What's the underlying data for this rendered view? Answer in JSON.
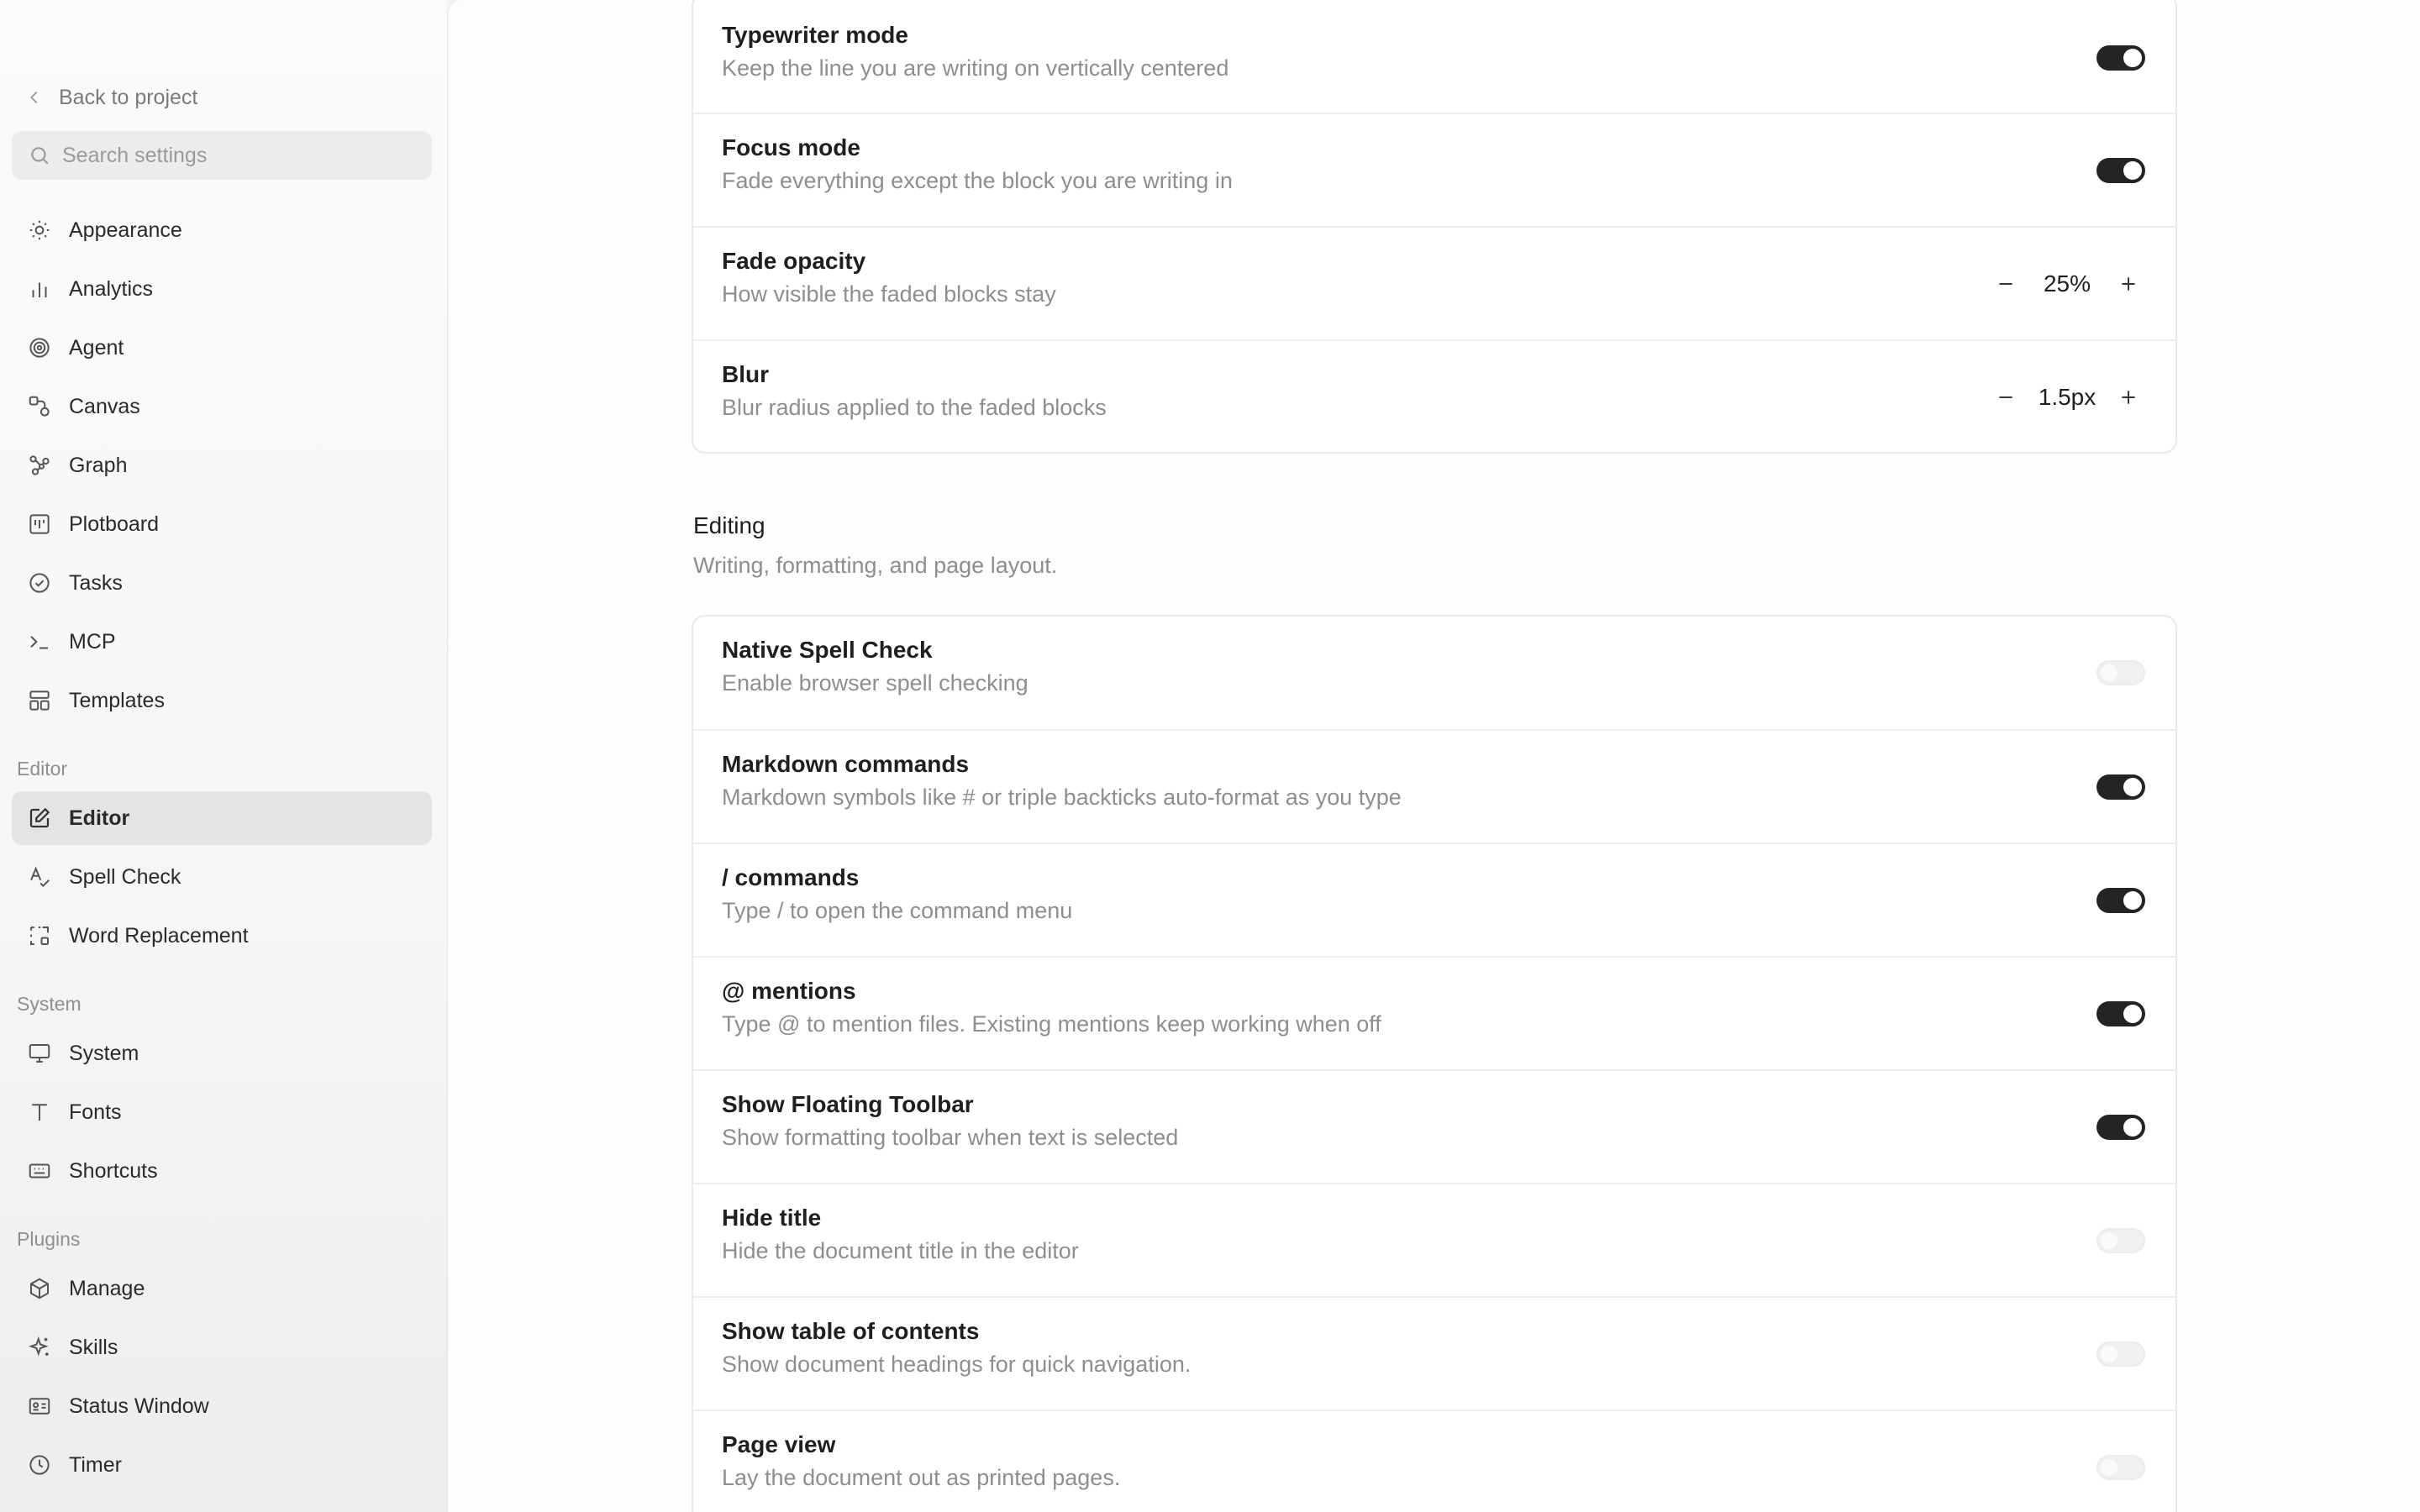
{
  "sidebar": {
    "back_label": "Back to project",
    "search_placeholder": "Search settings",
    "items": [
      {
        "label": "Appearance",
        "icon": "sun-icon"
      },
      {
        "label": "Analytics",
        "icon": "bar-chart-icon"
      },
      {
        "label": "Agent",
        "icon": "agent-icon"
      },
      {
        "label": "Canvas",
        "icon": "canvas-icon"
      },
      {
        "label": "Graph",
        "icon": "graph-icon"
      },
      {
        "label": "Plotboard",
        "icon": "plotboard-icon"
      },
      {
        "label": "Tasks",
        "icon": "check-circle-icon"
      },
      {
        "label": "MCP",
        "icon": "terminal-icon"
      },
      {
        "label": "Templates",
        "icon": "templates-icon"
      }
    ],
    "editor_section": {
      "title": "Editor",
      "items": [
        {
          "label": "Editor",
          "icon": "edit-icon",
          "active": true
        },
        {
          "label": "Spell Check",
          "icon": "spell-check-icon"
        },
        {
          "label": "Word Replacement",
          "icon": "replace-icon"
        }
      ]
    },
    "system_section": {
      "title": "System",
      "items": [
        {
          "label": "System",
          "icon": "monitor-icon"
        },
        {
          "label": "Fonts",
          "icon": "type-icon"
        },
        {
          "label": "Shortcuts",
          "icon": "keyboard-icon"
        }
      ]
    },
    "plugins_section": {
      "title": "Plugins",
      "items": [
        {
          "label": "Manage",
          "icon": "package-icon"
        },
        {
          "label": "Skills",
          "icon": "sparkles-icon"
        },
        {
          "label": "Status Window",
          "icon": "id-card-icon"
        },
        {
          "label": "Timer",
          "icon": "clock-icon"
        }
      ]
    }
  },
  "focus_card": {
    "rows": [
      {
        "title": "Typewriter mode",
        "desc": "Keep the line you are writing on vertically centered",
        "control": "toggle",
        "on": true
      },
      {
        "title": "Focus mode",
        "desc": "Fade everything except the block you are writing in",
        "control": "toggle",
        "on": true
      },
      {
        "title": "Fade opacity",
        "desc": "How visible the faded blocks stay",
        "control": "stepper",
        "value": "25%"
      },
      {
        "title": "Blur",
        "desc": "Blur radius applied to the faded blocks",
        "control": "stepper",
        "value": "1.5px"
      }
    ]
  },
  "editing_section": {
    "title": "Editing",
    "desc": "Writing, formatting, and page layout."
  },
  "editing_card": {
    "rows": [
      {
        "title": "Native Spell Check",
        "desc": "Enable browser spell checking",
        "on": false
      },
      {
        "title": "Markdown commands",
        "desc": "Markdown symbols like # or triple backticks auto-format as you type",
        "on": true
      },
      {
        "title": "/ commands",
        "desc": "Type / to open the command menu",
        "on": true
      },
      {
        "title": "@ mentions",
        "desc": "Type @ to mention files. Existing mentions keep working when off",
        "on": true
      },
      {
        "title": "Show Floating Toolbar",
        "desc": "Show formatting toolbar when text is selected",
        "on": true
      },
      {
        "title": "Hide title",
        "desc": "Hide the document title in the editor",
        "on": false
      },
      {
        "title": "Show table of contents",
        "desc": "Show document headings for quick navigation.",
        "on": false
      },
      {
        "title": "Page view",
        "desc": "Lay the document out as printed pages.",
        "on": false
      }
    ]
  },
  "colors": {
    "toggle_on": "#242424",
    "toggle_off": "#f0f0f0",
    "active_nav": "#e4e4e4"
  }
}
